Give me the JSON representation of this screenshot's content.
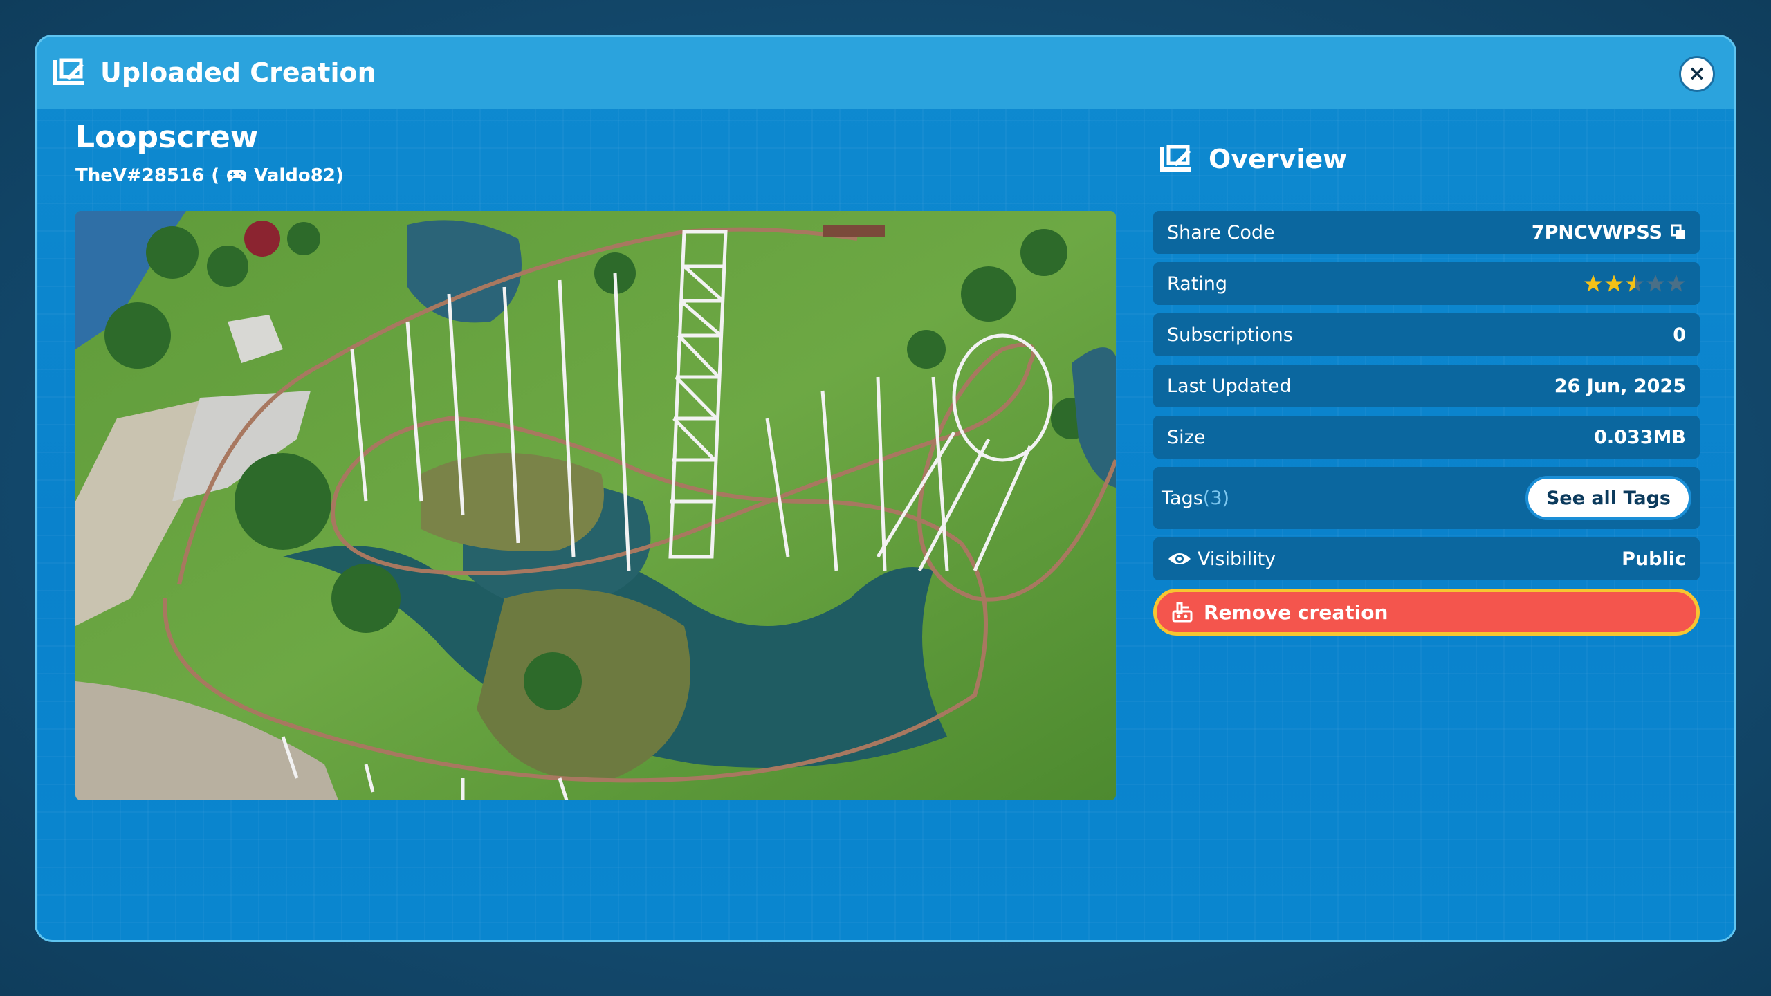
{
  "modal": {
    "title": "Uploaded Creation",
    "close_label": "×"
  },
  "creation": {
    "name": "Loopscrew",
    "creator_id": "TheV#28516",
    "creator_paren_open": "(",
    "creator_platform_name": "Valdo82)"
  },
  "overview": {
    "heading": "Overview",
    "share_code_label": "Share Code",
    "share_code_value": "7PNCVWPSS",
    "rating_label": "Rating",
    "rating_value": 2.5,
    "rating_max": 5,
    "subscriptions_label": "Subscriptions",
    "subscriptions_value": "0",
    "last_updated_label": "Last Updated",
    "last_updated_value": "26 Jun, 2025",
    "size_label": "Size",
    "size_value": "0.033MB",
    "tags_label": "Tags",
    "tags_count": "(3)",
    "see_all_tags_label": "See all Tags",
    "visibility_label": "Visibility",
    "visibility_value": "Public",
    "remove_label": "Remove creation"
  },
  "colors": {
    "star_filled": "#f4c117",
    "star_empty": "#4a6f87",
    "remove_bg": "#f4554d",
    "remove_border": "#f7c531"
  }
}
